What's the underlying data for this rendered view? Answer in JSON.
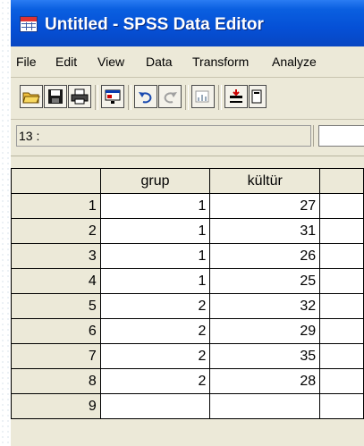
{
  "window": {
    "title": "Untitled - SPSS Data Editor"
  },
  "menu": [
    "File",
    "Edit",
    "View",
    "Data",
    "Transform",
    "Analyze"
  ],
  "toolbar": {
    "buttons": [
      "open-folder-icon",
      "save-disk-icon",
      "print-icon",
      "dialog-recall-icon",
      "undo-icon",
      "redo-icon",
      "goto-chart-icon",
      "goto-case-icon",
      "variables-icon"
    ]
  },
  "cell_editor": {
    "reference": "13 :",
    "value": ""
  },
  "grid": {
    "columns": [
      "grup",
      "kültür",
      ""
    ],
    "rows": [
      {
        "num": "1",
        "grup": "1",
        "kultur": "27"
      },
      {
        "num": "2",
        "grup": "1",
        "kultur": "31"
      },
      {
        "num": "3",
        "grup": "1",
        "kultur": "26"
      },
      {
        "num": "4",
        "grup": "1",
        "kultur": "25"
      },
      {
        "num": "5",
        "grup": "2",
        "kultur": "32"
      },
      {
        "num": "6",
        "grup": "2",
        "kultur": "29"
      },
      {
        "num": "7",
        "grup": "2",
        "kultur": "35"
      },
      {
        "num": "8",
        "grup": "2",
        "kultur": "28"
      },
      {
        "num": "9",
        "grup": "",
        "kultur": ""
      }
    ]
  },
  "colors": {
    "titlebar": "#0550d6",
    "chrome": "#ece9d8"
  }
}
